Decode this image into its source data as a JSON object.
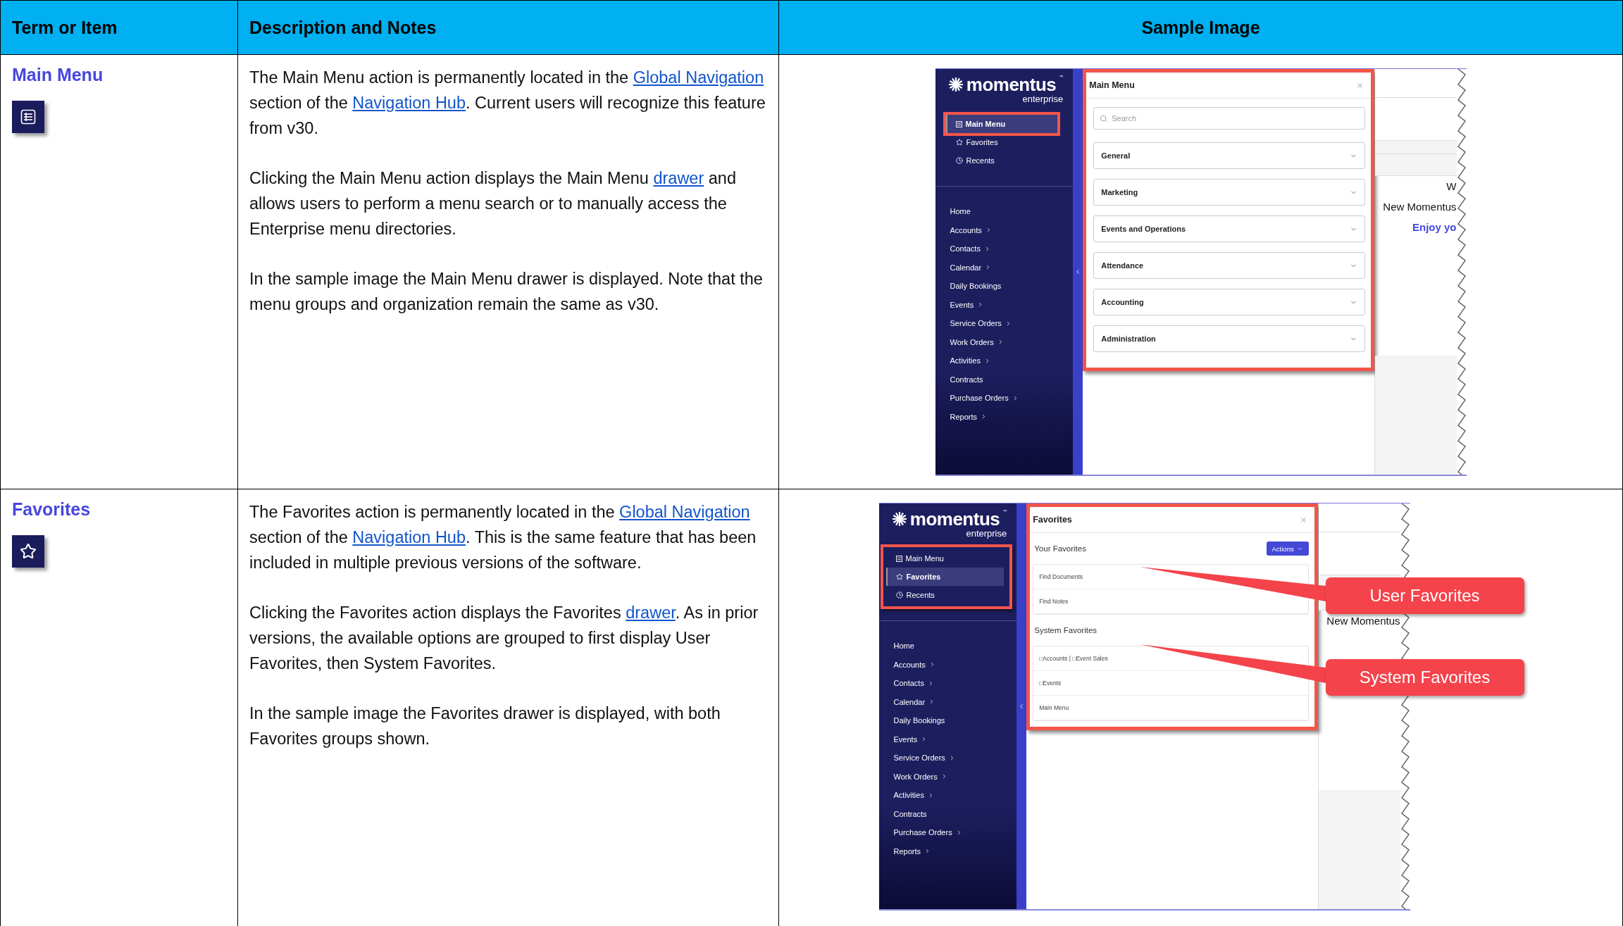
{
  "header": {
    "columns": [
      "Term or Item",
      "Description and Notes",
      "Sample Image"
    ]
  },
  "rows": [
    {
      "term": "Main Menu",
      "paragraphs": [
        [
          {
            "kind": "text",
            "text": "The Main Menu action is permanently located in the "
          },
          {
            "kind": "link",
            "text": "Global Navigation"
          },
          {
            "kind": "text",
            "text": " section of the "
          },
          {
            "kind": "link",
            "text": "Navigation Hub"
          },
          {
            "kind": "text",
            "text": ". Current users will recognize this feature from v30."
          }
        ],
        [
          {
            "kind": "text",
            "text": "Clicking the Main Menu action displays the Main Menu "
          },
          {
            "kind": "link",
            "text": "drawer"
          },
          {
            "kind": "text",
            "text": " and allows users to perform a menu search or to manually access the Enterprise menu directories."
          }
        ],
        [
          {
            "kind": "text",
            "text": "In the sample image the Main Menu drawer is displayed. Note that the menu groups and organization remain the same as v30."
          }
        ]
      ],
      "sample": {
        "logo": {
          "name": "momentus",
          "mark": "™",
          "sub": "enterprise"
        },
        "highlight_all": false,
        "quick_links": [
          {
            "label": "Main Menu",
            "selected": true
          },
          {
            "label": "Favorites",
            "selected": false
          },
          {
            "label": "Recents",
            "selected": false
          }
        ],
        "nav": [
          {
            "label": "Home",
            "has_submenu": false
          },
          {
            "label": "Accounts",
            "has_submenu": true
          },
          {
            "label": "Contacts",
            "has_submenu": true
          },
          {
            "label": "Calendar",
            "has_submenu": true
          },
          {
            "label": "Daily Bookings",
            "has_submenu": false
          },
          {
            "label": "Events",
            "has_submenu": true
          },
          {
            "label": "Service Orders",
            "has_submenu": true
          },
          {
            "label": "Work Orders",
            "has_submenu": true
          },
          {
            "label": "Activities",
            "has_submenu": true
          },
          {
            "label": "Contracts",
            "has_submenu": false
          },
          {
            "label": "Purchase Orders",
            "has_submenu": true
          },
          {
            "label": "Reports",
            "has_submenu": true
          }
        ],
        "drawer": {
          "kind": "menu",
          "title": "Main Menu",
          "placeholder": "Search",
          "groups": [
            "General",
            "Marketing",
            "Events and Operations",
            "Attendance",
            "Accounting",
            "Administration"
          ]
        },
        "background_texts": [
          {
            "kind": "plain",
            "text": "W"
          },
          {
            "kind": "plain",
            "text": "New Momentus"
          },
          {
            "kind": "accent",
            "text": "Enjoy yo"
          }
        ]
      }
    },
    {
      "term": "Favorites",
      "paragraphs": [
        [
          {
            "kind": "text",
            "text": "The Favorites action is permanently located in the "
          },
          {
            "kind": "link",
            "text": "Global Navigation"
          },
          {
            "kind": "text",
            "text": " section of the "
          },
          {
            "kind": "link",
            "text": "Navigation Hub"
          },
          {
            "kind": "text",
            "text": ". This is the same feature that has been included in multiple previous versions of the software."
          }
        ],
        [
          {
            "kind": "text",
            "text": "Clicking the Favorites action displays the Favorites "
          },
          {
            "kind": "link",
            "text": "drawer"
          },
          {
            "kind": "text",
            "text": ". As in prior versions, the available options are grouped to first display User Favorites, then System Favorites."
          }
        ],
        [
          {
            "kind": "text",
            "text": "In the sample image the Favorites drawer is displayed, with both Favorites groups shown."
          }
        ]
      ],
      "sample": {
        "logo": {
          "name": "momentus",
          "mark": "™",
          "sub": "enterprise"
        },
        "highlight_all": true,
        "quick_links": [
          {
            "label": "Main Menu",
            "selected": false
          },
          {
            "label": "Favorites",
            "selected": true
          },
          {
            "label": "Recents",
            "selected": false
          }
        ],
        "nav": [
          {
            "label": "Home",
            "has_submenu": false
          },
          {
            "label": "Accounts",
            "has_submenu": true
          },
          {
            "label": "Contacts",
            "has_submenu": true
          },
          {
            "label": "Calendar",
            "has_submenu": true
          },
          {
            "label": "Daily Bookings",
            "has_submenu": false
          },
          {
            "label": "Events",
            "has_submenu": true
          },
          {
            "label": "Service Orders",
            "has_submenu": true
          },
          {
            "label": "Work Orders",
            "has_submenu": true
          },
          {
            "label": "Activities",
            "has_submenu": true
          },
          {
            "label": "Contracts",
            "has_submenu": false
          },
          {
            "label": "Purchase Orders",
            "has_submenu": true
          },
          {
            "label": "Reports",
            "has_submenu": true
          }
        ],
        "drawer": {
          "kind": "favorites",
          "title": "Favorites",
          "sections": [
            {
              "title": "Your Favorites",
              "action": "Actions",
              "items": [
                "Find Documents",
                "Find Notes"
              ]
            },
            {
              "title": "System Favorites",
              "items": [
                "□Accounts | □Event Sales",
                "□Events",
                "Main Menu"
              ]
            }
          ]
        },
        "background_texts": [
          {
            "kind": "plain",
            "text": "New Momentus"
          }
        ],
        "callouts": [
          "User Favorites",
          "System Favorites"
        ]
      }
    }
  ]
}
